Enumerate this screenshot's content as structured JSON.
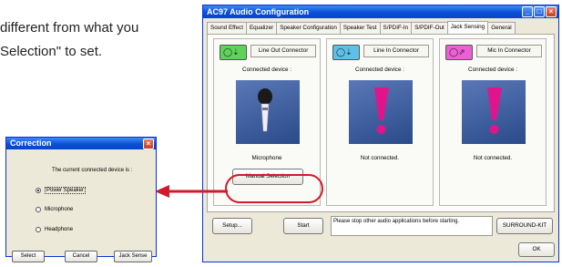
{
  "document": {
    "line1": "different from what you",
    "line2": "Selection\" to set."
  },
  "main_window": {
    "title": "AC97 Audio Configuration",
    "tabs": [
      {
        "label": "Sound Effect"
      },
      {
        "label": "Equalizer"
      },
      {
        "label": "Speaker Configuration"
      },
      {
        "label": "Speaker Test"
      },
      {
        "label": "S/PDIF-In"
      },
      {
        "label": "S/PDIF-Out"
      },
      {
        "label": "Jack Sensing"
      },
      {
        "label": "General"
      }
    ],
    "active_tab": "Jack Sensing",
    "connected_device_label": "Connected device :",
    "groups": [
      {
        "connector": "Line Out Connector",
        "status": "Microphone",
        "jack_color": "#5dd35a",
        "icon": "microphone-icon"
      },
      {
        "connector": "Line In Connector",
        "status": "Not connected.",
        "jack_color": "#5cc0e8",
        "icon": "exclamation-icon"
      },
      {
        "connector": "Mic In Connector",
        "status": "Not connected.",
        "jack_color": "#ee5fd6",
        "icon": "exclamation-icon"
      }
    ],
    "manual_selection_label": "Manual Selection",
    "setup_label": "Setup...",
    "start_label": "Start",
    "message": "Please stop other audio applications before starting.",
    "surround_label": "SURROUND-KIT",
    "ok_label": "OK"
  },
  "correction_dialog": {
    "title": "Correction",
    "prompt": "The current connected device is :",
    "options": [
      {
        "label": "Power Speaker",
        "selected": true
      },
      {
        "label": "Microphone",
        "selected": false
      },
      {
        "label": "Headphone",
        "selected": false
      }
    ],
    "select_label": "Select",
    "cancel_label": "Cancel",
    "jack_sense_label": "Jack Sense"
  },
  "colors": {
    "titlebar": "#0a4fd6",
    "highlight": "#d31a2a"
  }
}
